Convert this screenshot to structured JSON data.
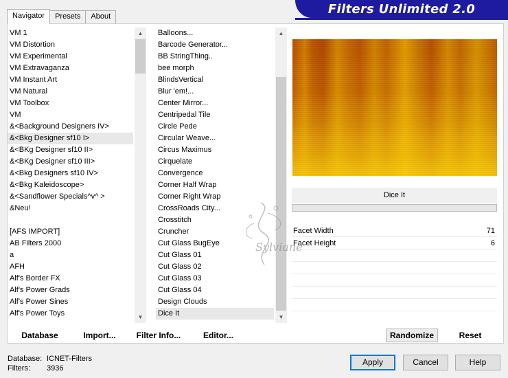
{
  "tabs": [
    {
      "label": "Navigator",
      "active": true
    },
    {
      "label": "Presets",
      "active": false
    },
    {
      "label": "About",
      "active": false
    }
  ],
  "banner_title": "Filters Unlimited 2.0",
  "categories": [
    "VM 1",
    "VM Distortion",
    "VM Experimental",
    "VM Extravaganza",
    "VM Instant Art",
    "VM Natural",
    "VM Toolbox",
    "VM",
    "&<Background Designers IV>",
    "&<Bkg Designer sf10 I>",
    "&<BKg Designer sf10 II>",
    "&<BKg Designer sf10 III>",
    "&<Bkg Designers sf10 IV>",
    "&<Bkg Kaleidoscope>",
    "&<Sandflower Specials^v^ >",
    "&Neu!",
    "",
    "[AFS IMPORT]",
    "AB Filters 2000",
    "a",
    "AFH",
    "Alf's Border FX",
    "Alf's Power Grads",
    "Alf's Power Sines",
    "Alf's Power Toys"
  ],
  "selected_category": "&<Bkg Designer sf10 I>",
  "filters": [
    "Balloons...",
    "Barcode Generator...",
    "BB StringThing..",
    "bee morph",
    "BlindsVertical",
    "Blur 'em!...",
    "Center Mirror...",
    "Centripedal Tile",
    "Circle Pede",
    "Circular Weave...",
    "Circus Maximus",
    "Cirquelate",
    "Convergence",
    "Corner Half Wrap",
    "Corner Right Wrap",
    "CrossRoads City...",
    "Crosstitch",
    "Cruncher",
    "Cut Glass  BugEye",
    "Cut Glass 01",
    "Cut Glass 02",
    "Cut Glass 03",
    "Cut Glass 04",
    "Design Clouds",
    "Dice It"
  ],
  "selected_filter": "Dice It",
  "current_filter_name": "Dice It",
  "params": [
    {
      "label": "Facet Width",
      "value": "71"
    },
    {
      "label": "Facet Height",
      "value": "6"
    }
  ],
  "buttons": {
    "database": "Database",
    "import": "Import...",
    "filter_info": "Filter Info...",
    "editor": "Editor...",
    "randomize": "Randomize",
    "reset": "Reset",
    "apply": "Apply",
    "cancel": "Cancel",
    "help": "Help"
  },
  "status": {
    "database_label": "Database:",
    "database_value": "ICNET-Filters",
    "filters_label": "Filters:",
    "filters_value": "3936"
  },
  "watermark_text": "Sylviane",
  "colors": {
    "banner": "#1e1ba1",
    "preview_dark": "#b84a00",
    "preview_light": "#ffd200"
  }
}
